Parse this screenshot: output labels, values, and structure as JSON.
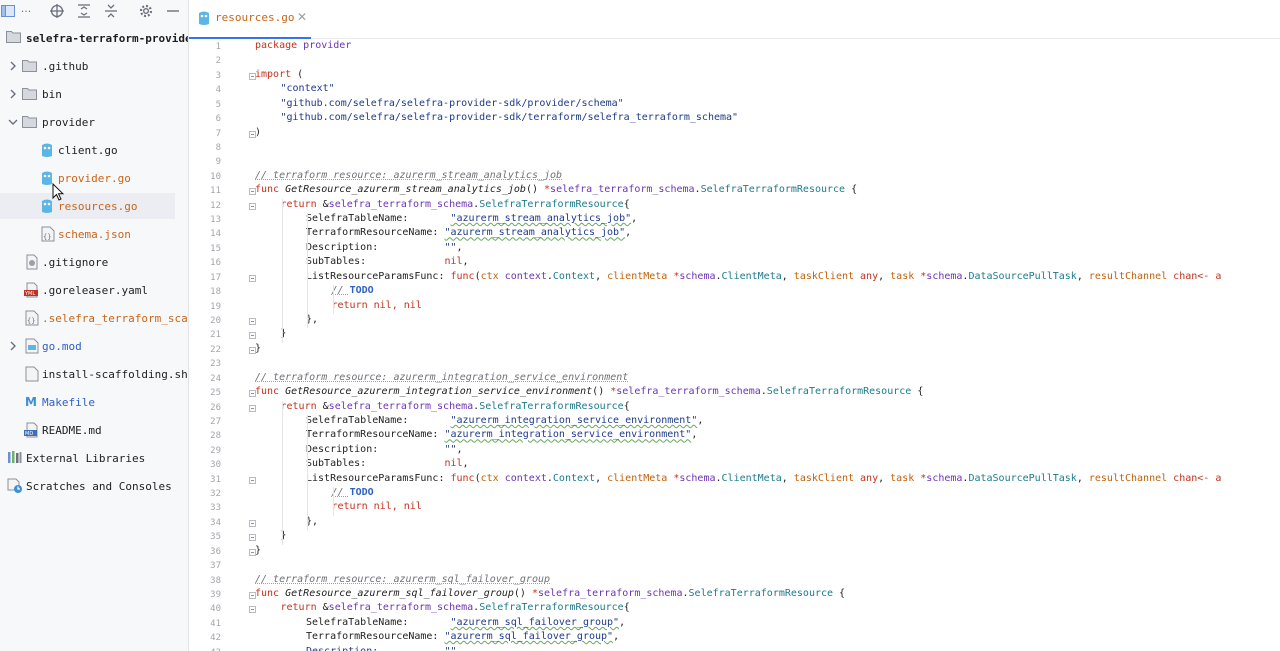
{
  "project": {
    "root_label": "selefra-terraform-provide",
    "items": [
      {
        "name": "github",
        "label": ".github",
        "kind": "folder"
      },
      {
        "name": "bin",
        "label": "bin",
        "kind": "folder"
      },
      {
        "name": "provider",
        "label": "provider",
        "kind": "folder"
      },
      {
        "name": "client",
        "label": "client.go",
        "kind": "go"
      },
      {
        "name": "provider-go",
        "label": "provider.go",
        "kind": "go"
      },
      {
        "name": "resources-go",
        "label": "resources.go",
        "kind": "go"
      },
      {
        "name": "schema-json",
        "label": "schema.json",
        "kind": "json"
      },
      {
        "name": "gitignore",
        "label": ".gitignore",
        "kind": "ignore"
      },
      {
        "name": "goreleaser",
        "label": ".goreleaser.yaml",
        "kind": "yaml"
      },
      {
        "name": "selefra-scaf",
        "label": ".selefra_terraform_scaf",
        "kind": "json"
      },
      {
        "name": "go-mod",
        "label": "go.mod",
        "kind": "mod"
      },
      {
        "name": "install-scaffolding",
        "label": "install-scaffolding.sh",
        "kind": "sh"
      },
      {
        "name": "makefile",
        "label": "Makefile",
        "kind": "make"
      },
      {
        "name": "readme",
        "label": "README.md",
        "kind": "md"
      },
      {
        "name": "external-libraries",
        "label": "External Libraries",
        "kind": "lib"
      },
      {
        "name": "scratches",
        "label": "Scratches and Consoles",
        "kind": "scratch"
      }
    ]
  },
  "tab": {
    "label": "resources.go"
  },
  "colors": {
    "accent": "#3574f0",
    "modified": "#c7661a",
    "go_icon": "#5bb5e6"
  },
  "editor": {
    "line_numbers": [
      "1",
      "2",
      "3",
      "4",
      "5",
      "6",
      "7",
      "8",
      "9",
      "10",
      "11",
      "12",
      "13",
      "14",
      "15",
      "16",
      "17",
      "18",
      "19",
      "20",
      "21",
      "22",
      "23",
      "24",
      "25",
      "26",
      "27",
      "28",
      "29",
      "30",
      "31",
      "32",
      "33",
      "34",
      "35",
      "36",
      "37",
      "38",
      "39",
      "40",
      "41",
      "42",
      "43"
    ],
    "code": {
      "l1_kw": "package",
      "l1_name": " provider",
      "l3_kw": "import",
      "l3_rest": " (",
      "l4": "\"context\"",
      "l5": "\"github.com/selefra/selefra-provider-sdk/provider/schema\"",
      "l6": "\"github.com/selefra/selefra-provider-sdk/terraform/selefra_terraform_schema\"",
      "l7": ")",
      "l10": "// terraform resource: azurerm_stream_analytics_job",
      "l11_fn": "GetResource_azurerm_stream_analytics_job",
      "l24": "// terraform resource: azurerm_integration_service_environment",
      "l25_fn": "GetResource_azurerm_integration_service_environment",
      "l38": "// terraform resource: azurerm_sql_failover_group",
      "l39_fn": "GetResource_azurerm_sql_failover_group",
      "func_kw": "func",
      "ret_open": "() ",
      "ret_type_ptr": "*",
      "ret_pkg": "selefra_terraform_schema",
      "dot": ".",
      "ret_type": "SelefraTerraformResource",
      "brace_open": " {",
      "return_kw": "return",
      "amp": " &",
      "lit_open": "{",
      "f_table": "SelefraTableName:       ",
      "f_tf": "TerraformResourceName: ",
      "f_desc": "Description:           ",
      "f_sub": "SubTables:             ",
      "f_list": "ListResourceParamsFunc: ",
      "v_job": "\"azurerm_stream_analytics_job\"",
      "v_ise": "\"azurerm_integration_service_environment\"",
      "v_sql": "\"azurerm_sql_failover_group\"",
      "v_empty": "\"\"",
      "comma": ",",
      "nil": "nil",
      "lp_func": "func",
      "lp_open": "(",
      "p_ctx": "ctx",
      "p_ctx_pkg": "context",
      "p_ctx_ty": "Context",
      "p_sep": ", ",
      "p_cm": "clientMeta",
      "p_ptr": " *",
      "p_schema": "schema",
      "p_cm_ty": "ClientMeta",
      "p_tc": "taskClient",
      "p_any": " any",
      "p_task": "task",
      "p_task_ty": "DataSourcePullTask",
      "p_rc": "resultChannel",
      "p_chan": " chan<- a",
      "todo_slash": "// ",
      "todo": "TODO",
      "ret_nils_kw": "return",
      "ret_nils": " nil, nil",
      "close_fn_lit": "},",
      "close_obj": "}",
      "close_func": "}",
      "desc_last": "Description:           \"\""
    }
  }
}
